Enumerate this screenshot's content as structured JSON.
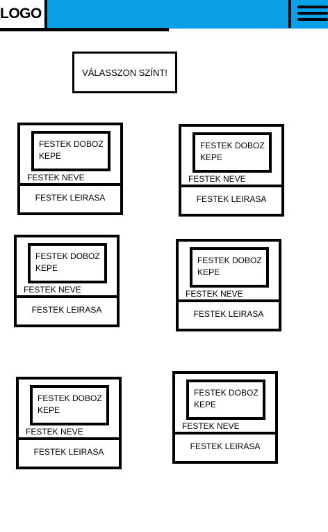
{
  "header": {
    "logo": "LOGO",
    "accent_color": "#0aa0e8",
    "menu_icon": "hamburger-menu-icon"
  },
  "main": {
    "title": "VÁLASSZON SZÍNT!"
  },
  "cards": [
    {
      "image_label": "FESTEK DOBOZ KEPE",
      "name": "FESTEK NEVE",
      "description": "FESTEK LEIRASA"
    },
    {
      "image_label": "FESTEK DOBOZ KEPE",
      "name": "FESTEK NEVE",
      "description": "FESTEK LEIRASA"
    },
    {
      "image_label": "FESTEK DOBOZ KEPE",
      "name": "FESTEK NEVE",
      "description": "FESTEK LEIRASA"
    },
    {
      "image_label": "FESTEK DOBOZ KEPE",
      "name": "FESTEK NEVE",
      "description": "FESTEK LEIRASA"
    },
    {
      "image_label": "FESTEK DOBOZ KEPE",
      "name": "FESTEK NEVE",
      "description": "FESTEK LEIRASA"
    },
    {
      "image_label": "FESTEK DOBOZ KEPE",
      "name": "FESTEK NEVE",
      "description": "FESTEK LEIRASA"
    }
  ]
}
